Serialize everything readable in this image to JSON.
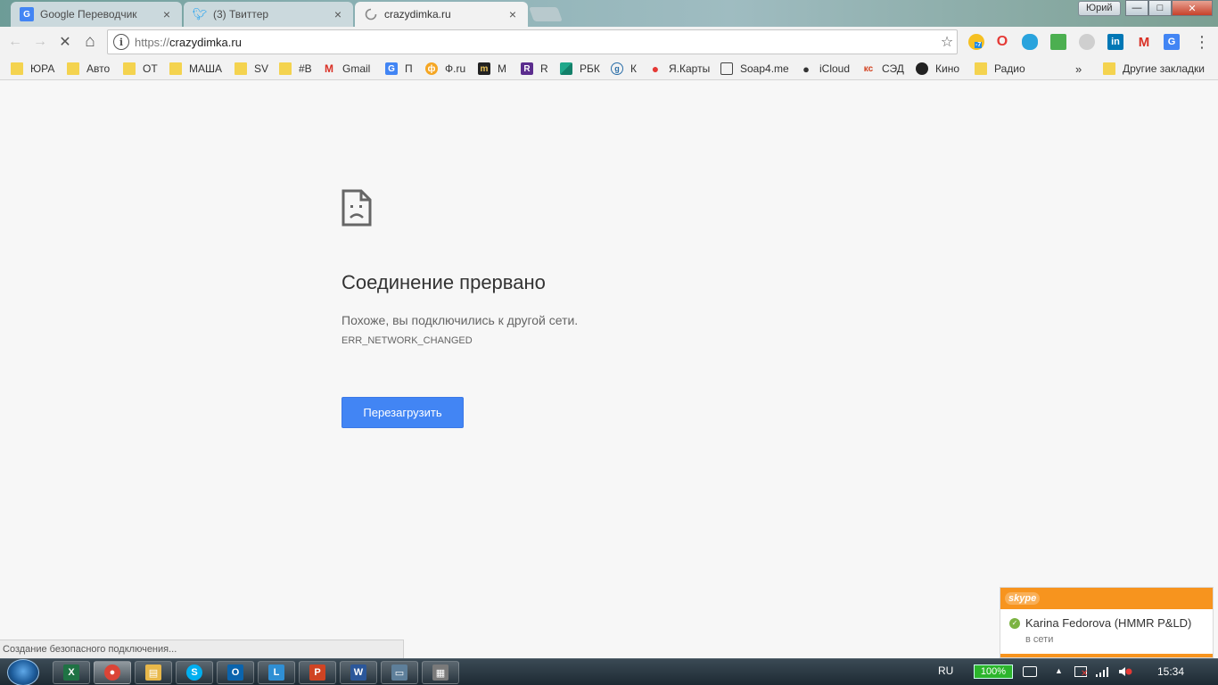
{
  "window": {
    "user_label": "Юрий",
    "minimize": "—",
    "maximize": "□",
    "close": "✕"
  },
  "tabs": [
    {
      "label": "Google Переводчик",
      "icon": "google-translate-icon",
      "close": "×"
    },
    {
      "label": "(3) Твиттер",
      "icon": "twitter-icon",
      "close": "×"
    },
    {
      "label": "crazydimka.ru",
      "icon": "loading-spinner-icon",
      "close": "×"
    }
  ],
  "toolbar": {
    "back": "←",
    "forward": "→",
    "stop": "✕",
    "home": "⌂",
    "info_glyph": "i",
    "url_scheme": "https://",
    "url_host": "crazydimka.ru",
    "star": "☆",
    "menu": "⋮",
    "ext_badge": "-7"
  },
  "bookmarks": [
    {
      "label": "ЮРА",
      "icon": "folder-icon"
    },
    {
      "label": "Авто",
      "icon": "folder-icon"
    },
    {
      "label": "ОТ",
      "icon": "folder-icon"
    },
    {
      "label": "МАША",
      "icon": "folder-icon"
    },
    {
      "label": "SV",
      "icon": "folder-icon"
    },
    {
      "label": "#B",
      "icon": "folder-icon"
    },
    {
      "label": "Gmail",
      "icon": "gmail-icon"
    },
    {
      "label": "П",
      "icon": "translate-icon"
    },
    {
      "label": "Ф.ru",
      "icon": "fru-icon"
    },
    {
      "label": "М",
      "icon": "m-icon"
    },
    {
      "label": "R",
      "icon": "r-icon"
    },
    {
      "label": "РБК",
      "icon": "rbk-icon"
    },
    {
      "label": "К",
      "icon": "k-icon"
    },
    {
      "label": "Я.Карты",
      "icon": "map-pin-icon"
    },
    {
      "label": "Soap4.me",
      "icon": "tv-icon"
    },
    {
      "label": "iCloud",
      "icon": "apple-icon"
    },
    {
      "label": "СЭД",
      "icon": "sed-icon"
    },
    {
      "label": "Кино",
      "icon": "kino-icon"
    },
    {
      "label": "Радио",
      "icon": "folder-icon"
    }
  ],
  "bookmarks_more": "»",
  "other_bookmarks": "Другие закладки",
  "error": {
    "title": "Соединение прервано",
    "message": "Похоже, вы подключились к другой сети.",
    "code": "ERR_NETWORK_CHANGED",
    "reload_label": "Перезагрузить"
  },
  "status_text": "Создание безопасного подключения...",
  "skype": {
    "logo": "skype",
    "contact_name": "Karina Fedorova (HMMR P&LD)",
    "contact_status": "в сети"
  },
  "taskbar": {
    "apps": [
      {
        "name": "excel",
        "glyph": "X",
        "color": "#1f7244"
      },
      {
        "name": "chrome",
        "glyph": "●",
        "color": "#db4437"
      },
      {
        "name": "explorer",
        "glyph": "▤",
        "color": "#e8b84a"
      },
      {
        "name": "skype",
        "glyph": "S",
        "color": "#00aff0"
      },
      {
        "name": "outlook",
        "glyph": "O",
        "color": "#0a64ad"
      },
      {
        "name": "lync",
        "glyph": "L",
        "color": "#2f8fd4"
      },
      {
        "name": "powerpoint",
        "glyph": "P",
        "color": "#d04423"
      },
      {
        "name": "word",
        "glyph": "W",
        "color": "#2b579a"
      },
      {
        "name": "window",
        "glyph": "▭",
        "color": "#5e7f9a"
      },
      {
        "name": "calculator",
        "glyph": "▦",
        "color": "#7a7a7a"
      }
    ],
    "language": "RU",
    "battery": "100%",
    "clock": "15:34"
  }
}
